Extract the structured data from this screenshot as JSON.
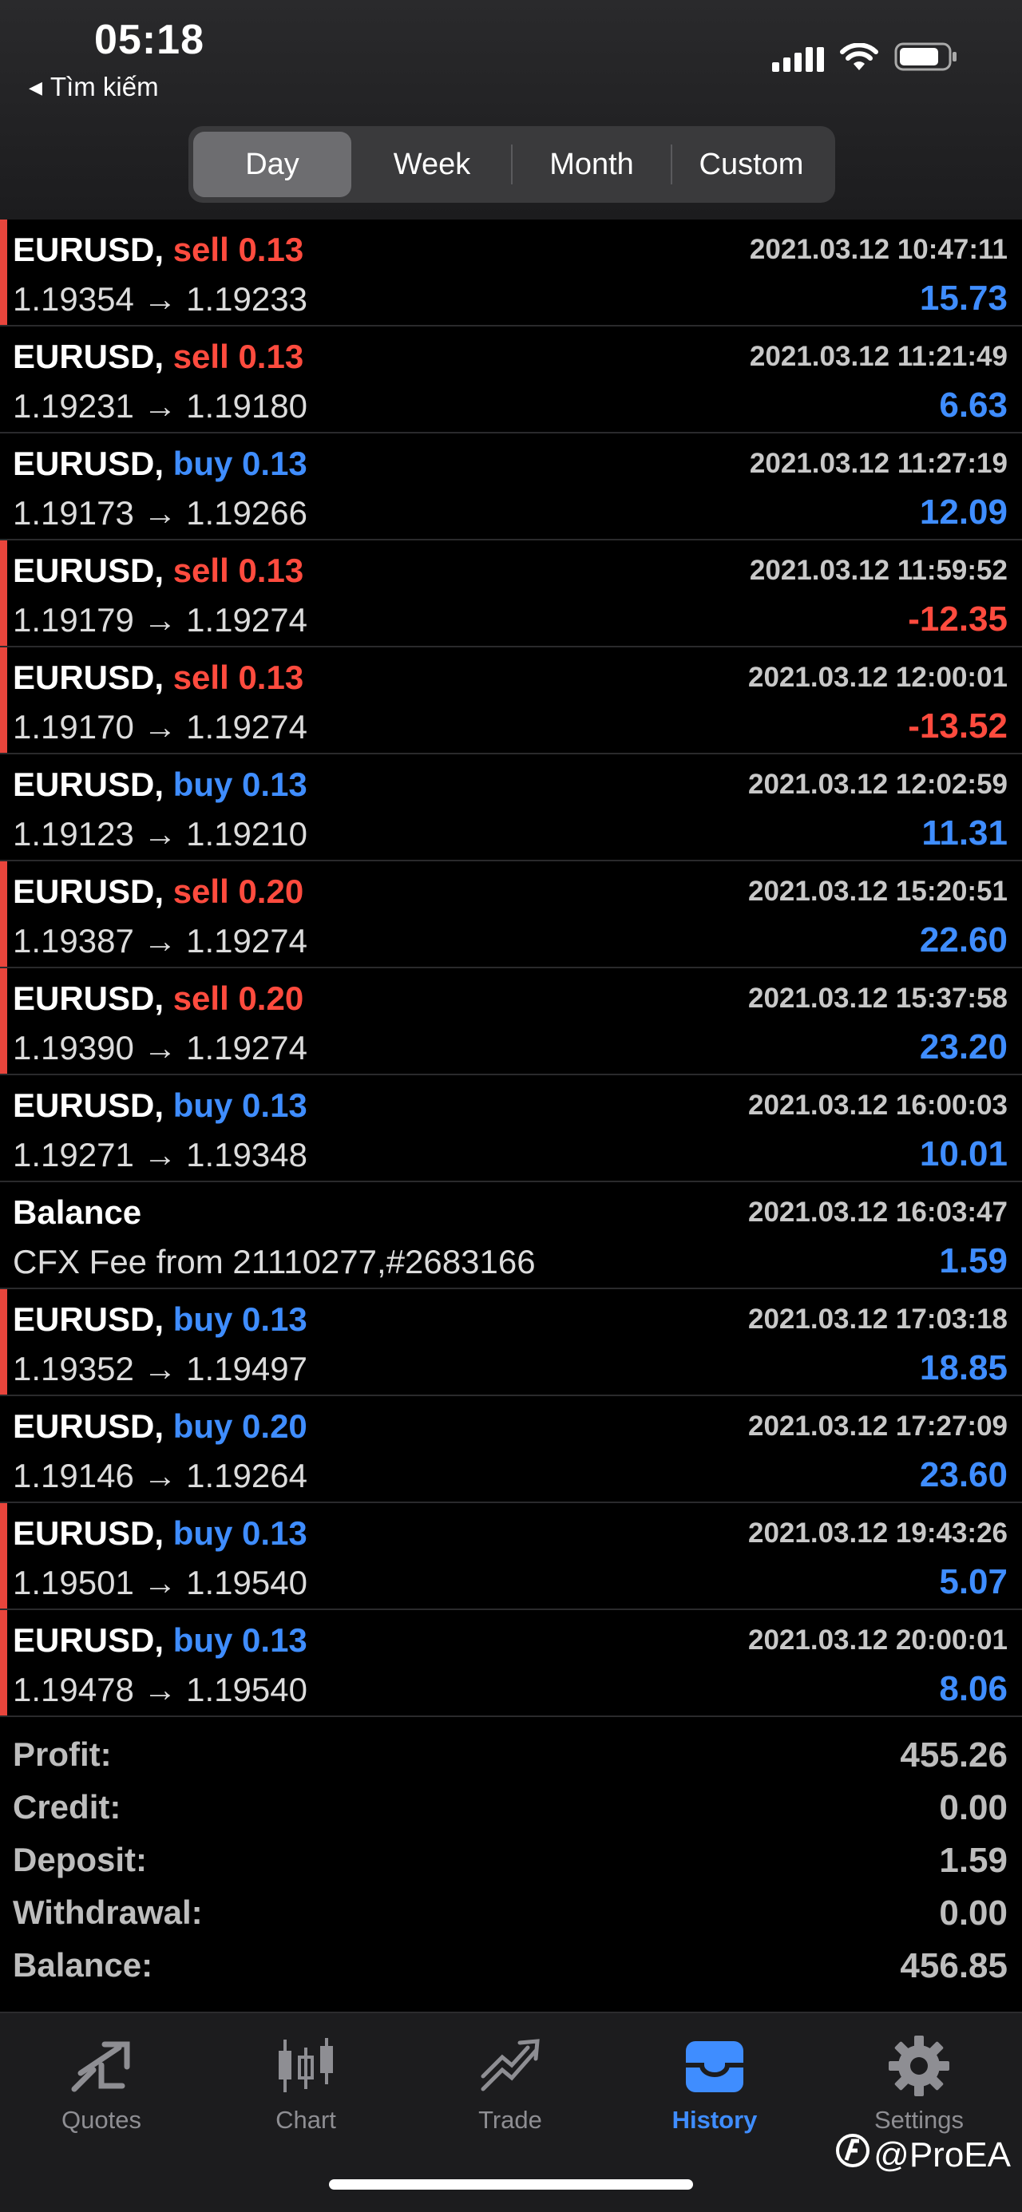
{
  "status": {
    "time": "05:18",
    "back_label": "Tìm kiếm"
  },
  "period_tabs": [
    {
      "label": "Day",
      "active": true
    },
    {
      "label": "Week",
      "active": false
    },
    {
      "label": "Month",
      "active": false
    },
    {
      "label": "Custom",
      "active": false
    }
  ],
  "deals": [
    {
      "symbol": "EURUSD,",
      "side": "sell",
      "volume": "0.13",
      "prices": "1.19354 → 1.19233",
      "datetime": "2021.03.12 10:47:11",
      "profit": "15.73",
      "marker": true
    },
    {
      "symbol": "EURUSD,",
      "side": "sell",
      "volume": "0.13",
      "prices": "1.19231 → 1.19180",
      "datetime": "2021.03.12 11:21:49",
      "profit": "6.63",
      "marker": false
    },
    {
      "symbol": "EURUSD,",
      "side": "buy",
      "volume": "0.13",
      "prices": "1.19173 → 1.19266",
      "datetime": "2021.03.12 11:27:19",
      "profit": "12.09",
      "marker": false
    },
    {
      "symbol": "EURUSD,",
      "side": "sell",
      "volume": "0.13",
      "prices": "1.19179 → 1.19274",
      "datetime": "2021.03.12 11:59:52",
      "profit": "-12.35",
      "marker": true
    },
    {
      "symbol": "EURUSD,",
      "side": "sell",
      "volume": "0.13",
      "prices": "1.19170 → 1.19274",
      "datetime": "2021.03.12 12:00:01",
      "profit": "-13.52",
      "marker": true
    },
    {
      "symbol": "EURUSD,",
      "side": "buy",
      "volume": "0.13",
      "prices": "1.19123 → 1.19210",
      "datetime": "2021.03.12 12:02:59",
      "profit": "11.31",
      "marker": false
    },
    {
      "symbol": "EURUSD,",
      "side": "sell",
      "volume": "0.20",
      "prices": "1.19387 → 1.19274",
      "datetime": "2021.03.12 15:20:51",
      "profit": "22.60",
      "marker": true
    },
    {
      "symbol": "EURUSD,",
      "side": "sell",
      "volume": "0.20",
      "prices": "1.19390 → 1.19274",
      "datetime": "2021.03.12 15:37:58",
      "profit": "23.20",
      "marker": true
    },
    {
      "symbol": "EURUSD,",
      "side": "buy",
      "volume": "0.13",
      "prices": "1.19271 → 1.19348",
      "datetime": "2021.03.12 16:00:03",
      "profit": "10.01",
      "marker": false
    },
    {
      "symbol": "Balance",
      "side": "",
      "volume": "",
      "prices": "CFX Fee from 21110277,#2683166",
      "datetime": "2021.03.12 16:03:47",
      "profit": "1.59",
      "marker": false
    },
    {
      "symbol": "EURUSD,",
      "side": "buy",
      "volume": "0.13",
      "prices": "1.19352 → 1.19497",
      "datetime": "2021.03.12 17:03:18",
      "profit": "18.85",
      "marker": true
    },
    {
      "symbol": "EURUSD,",
      "side": "buy",
      "volume": "0.20",
      "prices": "1.19146 → 1.19264",
      "datetime": "2021.03.12 17:27:09",
      "profit": "23.60",
      "marker": false
    },
    {
      "symbol": "EURUSD,",
      "side": "buy",
      "volume": "0.13",
      "prices": "1.19501 → 1.19540",
      "datetime": "2021.03.12 19:43:26",
      "profit": "5.07",
      "marker": true
    },
    {
      "symbol": "EURUSD,",
      "side": "buy",
      "volume": "0.13",
      "prices": "1.19478 → 1.19540",
      "datetime": "2021.03.12 20:00:01",
      "profit": "8.06",
      "marker": true
    }
  ],
  "summary": [
    {
      "label": "Profit:",
      "value": "455.26"
    },
    {
      "label": "Credit:",
      "value": "0.00"
    },
    {
      "label": "Deposit:",
      "value": "1.59"
    },
    {
      "label": "Withdrawal:",
      "value": "0.00"
    },
    {
      "label": "Balance:",
      "value": "456.85"
    }
  ],
  "tabbar": {
    "items": [
      {
        "label": "Quotes",
        "icon": "quotes-icon",
        "active": false
      },
      {
        "label": "Chart",
        "icon": "chart-icon",
        "active": false
      },
      {
        "label": "Trade",
        "icon": "trade-icon",
        "active": false
      },
      {
        "label": "History",
        "icon": "history-icon",
        "active": true
      },
      {
        "label": "Settings",
        "icon": "settings-icon",
        "active": false
      }
    ],
    "watermark": "@ProEA"
  },
  "colors": {
    "buy": "#3f8dff",
    "sell": "#ff4b3e",
    "marker": "#e8453c"
  }
}
